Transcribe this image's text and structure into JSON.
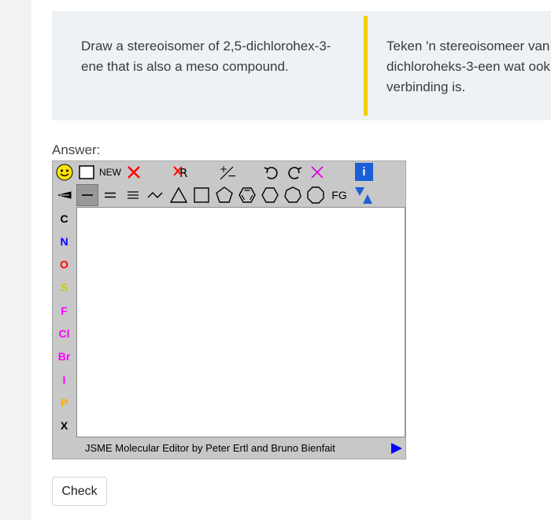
{
  "question": {
    "english": "Draw a stereoisomer of 2,5-dichlorohex-3-ene that is also a meso compound.",
    "afrikaans": "Teken 'n stereoisomeer van dichloroheks-3-een wat ook verbinding is."
  },
  "answer_label": "Answer:",
  "jsme": {
    "toolbar_top": {
      "new_label": "NEW",
      "fg_label": "FG",
      "info_label": "i"
    },
    "atoms": [
      "C",
      "N",
      "O",
      "S",
      "F",
      "Cl",
      "Br",
      "I",
      "P",
      "X"
    ],
    "status_text": "JSME Molecular Editor by Peter Ertl and Bruno Bienfait",
    "colors": {
      "C": "#000000",
      "N": "#0000ff",
      "O": "#ff0000",
      "S": "#c8c800",
      "F": "#ff00ff",
      "Cl": "#ff00ff",
      "Br": "#ff00ff",
      "I": "#ff00ff",
      "P": "#ffaa00",
      "X": "#000000"
    }
  },
  "check_label": "Check"
}
